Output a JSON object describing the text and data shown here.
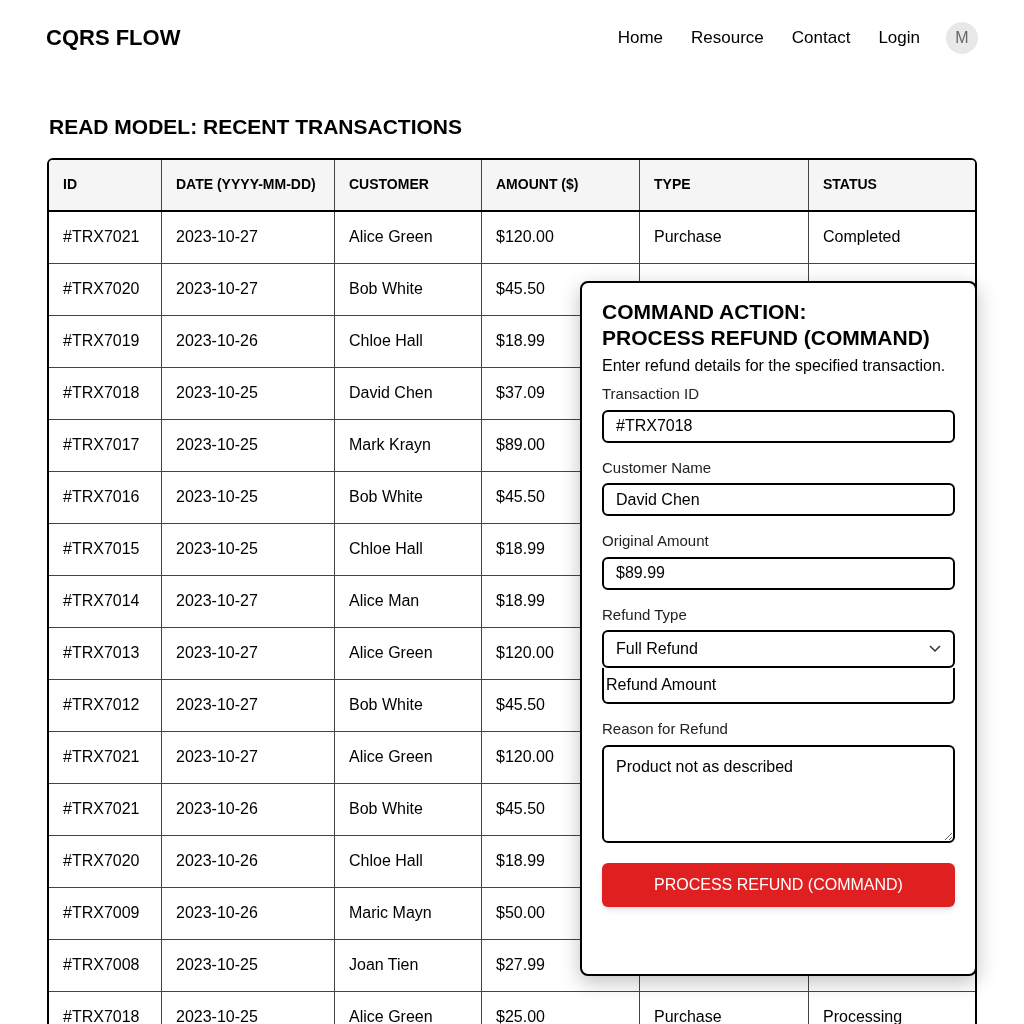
{
  "brand": "CQRS FLOW",
  "nav": [
    "Home",
    "Resource",
    "Contact",
    "Login"
  ],
  "avatar": "M",
  "section_title": "READ MODEL: RECENT TRANSACTIONS",
  "table": {
    "columns": [
      "ID",
      "DATE (YYYY-MM-DD)",
      "CUSTOMER",
      "AMOUNT ($)",
      "TYPE",
      "STATUS"
    ],
    "rows": [
      [
        "#TRX7021",
        "2023-10-27",
        "Alice Green",
        "$120.00",
        "Purchase",
        "Completed"
      ],
      [
        "#TRX7020",
        "2023-10-27",
        "Bob White",
        "$45.50"
      ],
      [
        "#TRX7019",
        "2023-10-26",
        "Chloe Hall",
        "$18.99"
      ],
      [
        "#TRX7018",
        "2023-10-25",
        "David Chen",
        "$37.09"
      ],
      [
        "#TRX7017",
        "2023-10-25",
        "Mark Krayn",
        "$89.00"
      ],
      [
        "#TRX7016",
        "2023-10-25",
        "Bob White",
        "$45.50"
      ],
      [
        "#TRX7015",
        "2023-10-25",
        "Chloe Hall",
        "$18.99"
      ],
      [
        "#TRX7014",
        "2023-10-27",
        "Alice Man",
        "$18.99"
      ],
      [
        "#TRX7013",
        "2023-10-27",
        "Alice Green",
        "$120.00"
      ],
      [
        "#TRX7012",
        "2023-10-27",
        "Bob White",
        "$45.50"
      ],
      [
        "#TRX7021",
        "2023-10-27",
        "Alice Green",
        "$120.00"
      ],
      [
        "#TRX7021",
        "2023-10-26",
        "Bob White",
        "$45.50"
      ],
      [
        "#TRX7020",
        "2023-10-26",
        "Chloe Hall",
        "$18.99"
      ],
      [
        "#TRX7009",
        "2023-10-26",
        "Maric Mayn",
        "$50.00"
      ],
      [
        "#TRX7008",
        "2023-10-25",
        "Joan Tien",
        "$27.99"
      ],
      [
        "#TRX7018",
        "2023-10-25",
        "Alice Green",
        "$25.00",
        "Purchase",
        "Processing"
      ]
    ]
  },
  "panel": {
    "title_lines": [
      "COMMAND ACTION:",
      "PROCESS REFUND (COMMAND)"
    ],
    "description": "Enter refund details for the specified transaction.",
    "fields": [
      {
        "kind": "text",
        "label": "Transaction ID",
        "value": "#TRX7018"
      },
      {
        "kind": "text",
        "label": "Customer Name",
        "value": "David Chen"
      },
      {
        "kind": "text",
        "label": "Original Amount",
        "value": "$89.99"
      },
      {
        "kind": "select",
        "label": "Refund Type",
        "value": "Full Refund",
        "extra_placeholder": "Refund Amount"
      },
      {
        "kind": "textarea",
        "label": "Reason for Refund",
        "value": "Product not as described"
      }
    ],
    "submit": "PROCESS REFUND (COMMAND)"
  }
}
